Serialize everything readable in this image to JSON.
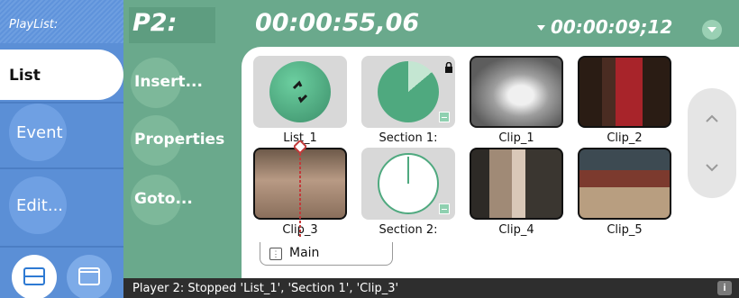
{
  "sidebar": {
    "header": "PlayList:",
    "tabs": [
      {
        "label": "List",
        "selected": true
      },
      {
        "label": "Event",
        "selected": false
      },
      {
        "label": "Edit...",
        "selected": false
      }
    ],
    "view_buttons": [
      {
        "icon": "stacked-view-icon",
        "selected": true
      },
      {
        "icon": "single-view-icon",
        "selected": false
      }
    ]
  },
  "header": {
    "player": "P2:",
    "timecode": "00:00:55,06",
    "duration": "00:00:09;12"
  },
  "actions": [
    {
      "label": "Insert..."
    },
    {
      "label": "Properties"
    },
    {
      "label": "Goto..."
    }
  ],
  "clips": [
    {
      "label": "List_1",
      "kind": "list"
    },
    {
      "label": "Section 1:",
      "kind": "section",
      "locked": true
    },
    {
      "label": "Clip_1",
      "kind": "clip"
    },
    {
      "label": "Clip_2",
      "kind": "clip"
    },
    {
      "label": "Clip_3",
      "kind": "clip",
      "playhead": true
    },
    {
      "label": "Section 2:",
      "kind": "section"
    },
    {
      "label": "Clip_4",
      "kind": "clip"
    },
    {
      "label": "Clip_5",
      "kind": "clip"
    }
  ],
  "tabs": [
    {
      "label": "Main"
    }
  ],
  "status": {
    "text": "Player 2: Stopped 'List_1', 'Section 1', 'Clip_3'",
    "info": "i"
  },
  "colors": {
    "left_panel": "#5b8fd6",
    "right_panel": "#6aa98c",
    "status_bar": "#2e2e2e",
    "accent_green": "#4fa97f"
  }
}
